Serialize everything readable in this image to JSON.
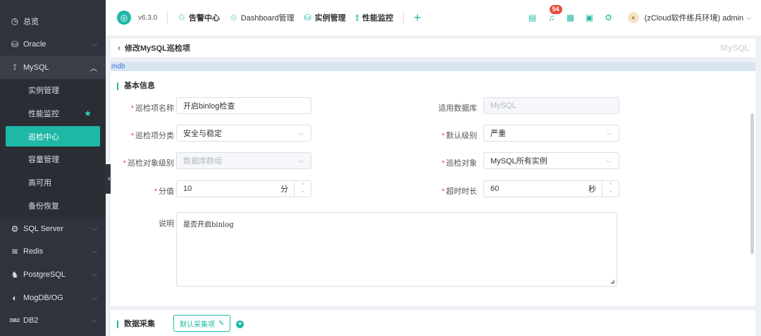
{
  "sidebar": {
    "items": [
      {
        "label": "总览",
        "icon": "clock-icon"
      },
      {
        "label": "Oracle",
        "icon": "database-icon"
      },
      {
        "label": "MySQL",
        "icon": "mysql-icon"
      },
      {
        "label": "SQL Server",
        "icon": "sqlserver-icon"
      },
      {
        "label": "Redis",
        "icon": "redis-icon"
      },
      {
        "label": "PostgreSQL",
        "icon": "postgresql-icon"
      },
      {
        "label": "MogDB/OG",
        "icon": "mogdb-icon"
      },
      {
        "label": "DB2",
        "icon": "db2-icon"
      }
    ],
    "mysql_sub": [
      "实例管理",
      "性能监控",
      "巡检中心",
      "容量管理",
      "高可用",
      "备份恢复"
    ]
  },
  "topbar": {
    "version": "v6.3.0",
    "nav": [
      "告警中心",
      "Dashboard管理",
      "实例管理",
      "性能监控"
    ],
    "badge": "54",
    "user": "(zCloud软件练兵环境) admin"
  },
  "page": {
    "title": "修改MySQL巡检项",
    "tag": "MySQL",
    "strip": "mdb"
  },
  "basic": {
    "section_title": "基本信息",
    "name_label": "巡检项名称",
    "name_value": "开启binlog检查",
    "db_label": "适用数据库",
    "db_value": "MySQL",
    "category_label": "巡检项分类",
    "category_value": "安全与稳定",
    "level_label": "默认级别",
    "level_value": "严重",
    "target_level_label": "巡检对象级别",
    "target_level_value": "数据库群组",
    "target_label": "巡检对象",
    "target_value": "MySQL所有实例",
    "score_label": "分值",
    "score_value": "10",
    "score_unit": "分",
    "timeout_label": "超时时长",
    "timeout_value": "60",
    "timeout_unit": "秒",
    "desc_label": "说明",
    "desc_value": "是否开启binlog"
  },
  "collect": {
    "section_title": "数据采集",
    "button_label": "默认采集项"
  },
  "colors": {
    "accent": "#1fb8a6",
    "sidebar": "#30333b",
    "badge": "#e84c3d"
  }
}
